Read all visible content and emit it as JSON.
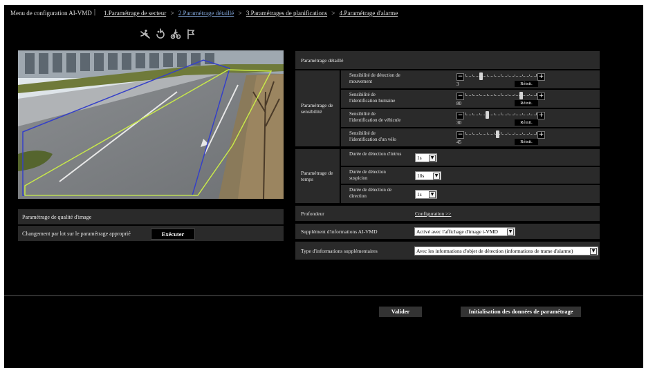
{
  "header": {
    "title": "Menu de configuration AI-VMD",
    "separator": "|",
    "steps": [
      {
        "label": "1.Paramétrage de secteur",
        "active": false
      },
      {
        "label": "2.Paramétrage détaillé",
        "active": true
      },
      {
        "label": "3.Paramétrages de planifications",
        "active": false
      },
      {
        "label": "4.Paramétrage d'alarme",
        "active": false
      }
    ],
    "arrow": ">"
  },
  "tools": [
    "intruder-icon",
    "loitering-icon",
    "direction-icon",
    "flag-icon"
  ],
  "left": {
    "quality_label": "Paramétrage de qualité d'image",
    "batch_label": "Changement par lot sur le paramétrage approprié",
    "execute_label": "Exécuter"
  },
  "detail": {
    "title": "Paramétrage détaillé",
    "sensitivity_group": "Paramétrage de sensibilité",
    "sensitivity": [
      {
        "label": "Sensibilité de détection de mouvement",
        "value": "3",
        "level": 0.2
      },
      {
        "label": "Sensibilité de l'identification humaine",
        "value": "80",
        "level": 0.8
      },
      {
        "label": "Sensibilité de l'identification de véhicule",
        "value": "30",
        "level": 0.3
      },
      {
        "label": "Sensibilité de l'identification d'un vélo",
        "value": "45",
        "level": 0.45
      }
    ],
    "minus": "−",
    "plus": "+",
    "reset_label": "Réinit.",
    "time_group": "Paramétrage de temps",
    "times": [
      {
        "label": "Durée de détection d'intrus",
        "value": "1s"
      },
      {
        "label": "Durée de détection suspicion",
        "value": "10s"
      },
      {
        "label": "Durée de détection de direction",
        "value": "1s"
      }
    ],
    "depth_label": "Profondeur",
    "depth_link": "Configuration >>",
    "info_label": "Supplément d'informations AI-VMD",
    "info_value": "Activé avec l'affichage d'image i-VMD",
    "type_label": "Type d'informations supplémentaires",
    "type_value": "Avec les informations d'objet de détection (informations de trame d'alarme)",
    "caret": "▼"
  },
  "footer": {
    "apply_label": "Valider",
    "init_label": "Initialisation des données de paramétrage"
  },
  "colors": {
    "background": "#000000",
    "panel": "#2a2a2a",
    "active_step": "#7fa3d6",
    "zone_blue": "#3540c8",
    "zone_yellow": "#c8e84a"
  }
}
